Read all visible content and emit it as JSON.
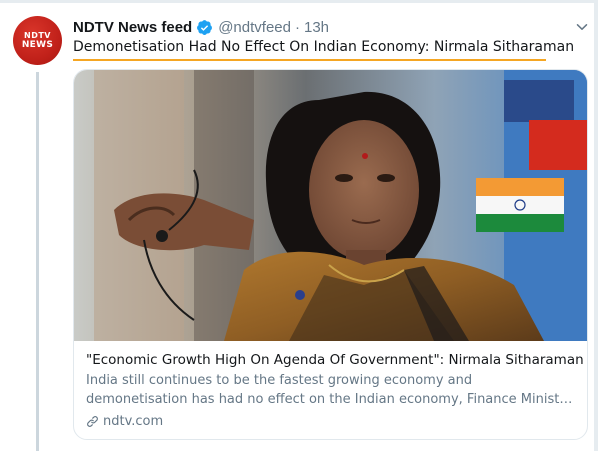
{
  "tweet": {
    "avatar_line1": "NDTV",
    "avatar_line2": "NEWS",
    "display_name": "NDTV News feed",
    "handle": "@ndtvfeed",
    "separator": "·",
    "time": "13h",
    "text": "Demonetisation Had No Effect On Indian Economy: Nirmala Sitharaman"
  },
  "card": {
    "title": "\"Economic Growth High On Agenda Of Government\": Nirmala Sitharaman",
    "description_line1": "India still continues to be the fastest growing economy and",
    "description_line2": "demonetisation has had no effect on the Indian economy, Finance Minist…",
    "domain": "ndtv.com"
  },
  "colors": {
    "highlight_underline": "#f5a623",
    "verified_badge": "#1da1f2",
    "secondary_text": "#657786"
  },
  "icons": {
    "verified": "verified-badge-icon",
    "caret": "chevron-down-icon",
    "link": "link-icon"
  }
}
